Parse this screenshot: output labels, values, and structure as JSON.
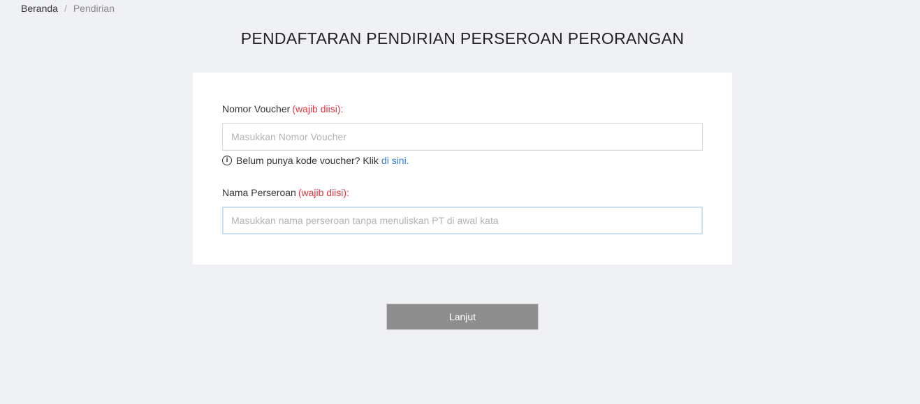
{
  "breadcrumb": {
    "home": "Beranda",
    "separator": "/",
    "current": "Pendirian"
  },
  "page_title": "PENDAFTARAN PENDIRIAN PERSEROAN PERORANGAN",
  "form": {
    "voucher": {
      "label": "Nomor Voucher",
      "required": "(wajib diisi):",
      "placeholder": "Masukkan Nomor Voucher",
      "value": ""
    },
    "hint": {
      "icon": "info-icon",
      "text": "Belum punya kode voucher? Klik",
      "link": "di sini."
    },
    "company_name": {
      "label": "Nama Perseroan",
      "required": "(wajib diisi):",
      "placeholder": "Masukkan nama perseroan tanpa menuliskan PT di awal kata",
      "value": ""
    }
  },
  "continue_button": "Lanjut",
  "colors": {
    "required": "#e0363e",
    "link": "#2f7fd0",
    "button": "#8e8e8e",
    "background": "#f0f1f5"
  }
}
